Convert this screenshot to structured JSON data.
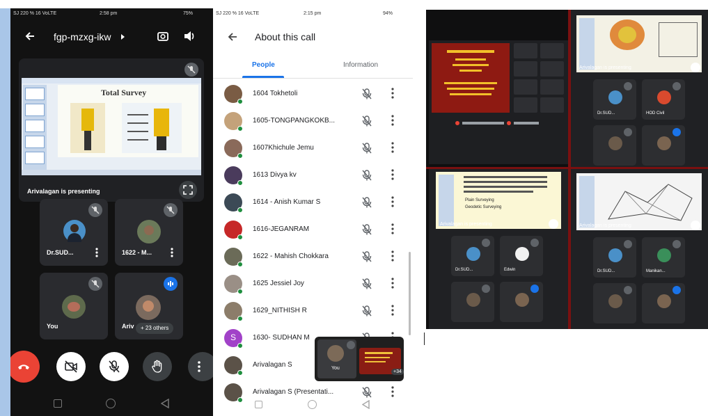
{
  "phone1": {
    "status_left": "SJ 220 % 16 VoLTE",
    "status_time": "2:58 pm",
    "status_right": "75%",
    "meeting_code": "fgp-mzxg-ikw",
    "presentation": {
      "slide_title": "Total Survey",
      "presenting_label": "Arivalagan is presenting"
    },
    "tiles": [
      {
        "name": "Dr.SUD...",
        "muted": true
      },
      {
        "name": "1622 - M...",
        "muted": true
      },
      {
        "name": "You",
        "muted": true
      },
      {
        "name": "Ariv",
        "others_label": "+ 23 others",
        "speaking": true
      }
    ]
  },
  "phone2": {
    "status_left": "SJ 220 % 16 VoLTE",
    "status_time": "2:15 pm",
    "status_right": "94%",
    "title": "About this call",
    "tabs": [
      "People",
      "Information"
    ],
    "active_tab": "People",
    "people": [
      {
        "name": "1604 Tokhetoli",
        "color": "#7a5c44"
      },
      {
        "name": "1605-TONGPANGKOKB...",
        "color": "#c4a27a"
      },
      {
        "name": "1607Khichule Jemu",
        "color": "#8a6a5a"
      },
      {
        "name": "1613 Divya kv",
        "color": "#4a3b5c"
      },
      {
        "name": "1614 - Anish Kumar S",
        "color": "#3c4a56"
      },
      {
        "name": "1616-JEGANRAM",
        "color": "#c62828"
      },
      {
        "name": "1622 - Mahish Chokkara",
        "color": "#6b6b58"
      },
      {
        "name": "1625 Jessiel Joy",
        "color": "#9a8f86"
      },
      {
        "name": "1629_NITHISH R",
        "color": "#8c7d6a"
      },
      {
        "name": "1630- SUDHAN M",
        "color": "#a142c8",
        "initial": "S"
      },
      {
        "name": "Arivalagan S",
        "color": "#5b5248"
      },
      {
        "name": "Arivalagan S (Presentati...",
        "color": "#5b5248"
      }
    ],
    "pip": {
      "self_label": "You",
      "more_label": "+34"
    }
  },
  "desktop": {
    "q1": {
      "slide_heading": "",
      "toolbar": ""
    },
    "q2": {
      "presenting_label": "Arivalagan is presenting",
      "tiles": [
        {
          "name": "Dr.SUD..."
        },
        {
          "name": "HOD Civil"
        },
        {
          "name": ""
        },
        {
          "name": ""
        }
      ]
    },
    "q3": {
      "presenting_label": "Arivalagan is presenting",
      "slide_bullets": [
        "Plain Surveying",
        "Geodetic Surveying"
      ],
      "tiles": [
        {
          "name": "Dr.SUD..."
        },
        {
          "name": "Edwin"
        },
        {
          "name": ""
        },
        {
          "name": ""
        }
      ]
    },
    "q4": {
      "presenting_label": "Arivalagan is presenting",
      "tiles": [
        {
          "name": "Dr.SUD..."
        },
        {
          "name": "Manikan..."
        },
        {
          "name": ""
        },
        {
          "name": ""
        }
      ]
    }
  },
  "colors": {
    "end_call_red": "#ea4335",
    "google_blue": "#1a73e8",
    "online_green": "#1e8e3e",
    "background_blue": "#a9c6e8"
  },
  "icons": {
    "back": "arrow-left-icon",
    "camera_switch": "camera-switch-icon",
    "speaker": "speaker-icon",
    "mic_off": "mic-off-icon",
    "more": "more-vert-icon",
    "fullscreen": "fullscreen-icon",
    "end_call": "end-call-icon",
    "video_off": "video-off-icon",
    "raise_hand": "hand-icon"
  }
}
